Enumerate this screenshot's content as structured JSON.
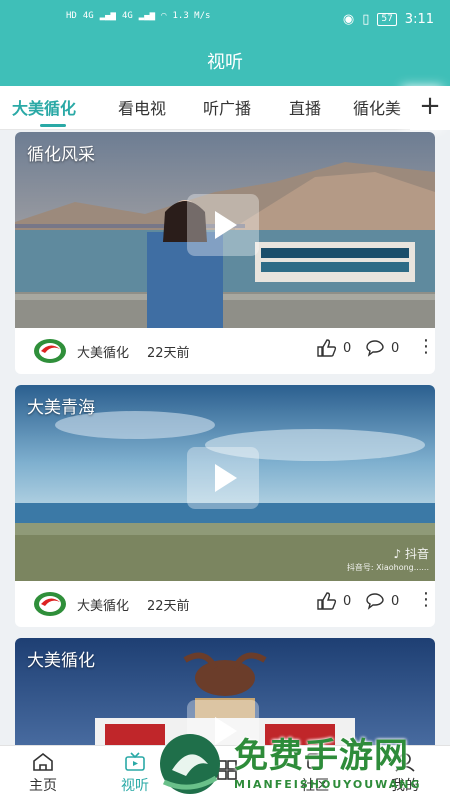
{
  "status_bar": {
    "left": [
      "HD",
      "4G",
      "4G",
      "1.3 M/s"
    ],
    "battery": "57",
    "time": "3:11"
  },
  "header": {
    "title": "视听"
  },
  "tabs": [
    {
      "label": "大美循化",
      "active": true
    },
    {
      "label": "看电视",
      "active": false
    },
    {
      "label": "听广播",
      "active": false
    },
    {
      "label": "直播",
      "active": false
    },
    {
      "label": "循化美",
      "active": false
    }
  ],
  "add_tab_icon": "plus-icon",
  "cards": [
    {
      "title": "循化风采",
      "source": "大美循化",
      "time": "22天前",
      "likes": "0",
      "comments": "0"
    },
    {
      "title": "大美青海",
      "source": "大美循化",
      "time": "22天前",
      "likes": "0",
      "comments": "0",
      "watermark": {
        "brand": "♪ 抖音",
        "account": "抖音号: Xiaohong......"
      }
    },
    {
      "title": "大美循化"
    }
  ],
  "bottom_nav": [
    {
      "label": "主页",
      "icon": "home-icon",
      "active": false
    },
    {
      "label": "视听",
      "icon": "tv-icon",
      "active": true
    },
    {
      "label": "",
      "icon": "grid-icon",
      "active": false
    },
    {
      "label": "社区",
      "icon": "community-icon",
      "active": false
    },
    {
      "label": "我的",
      "icon": "user-icon",
      "active": false
    }
  ],
  "overlay_watermark": {
    "text": "免费手游网",
    "sub": "MIANFEISHOUYOUWANG"
  },
  "colors": {
    "brand": "#3fbfb8",
    "accent": "#2aa9a6"
  }
}
